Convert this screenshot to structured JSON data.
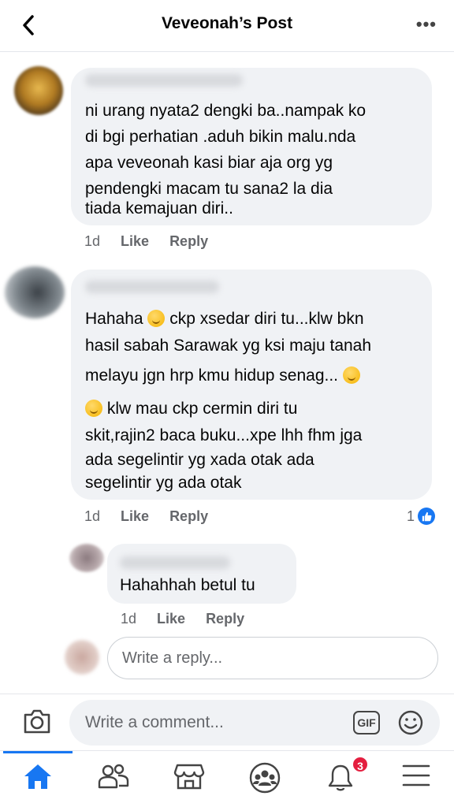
{
  "header": {
    "title": "Veveonah’s Post",
    "back_icon": "chevron-left-icon",
    "more_icon": "ellipsis-icon"
  },
  "comments": [
    {
      "lines": [
        "ni urang nyata2 dengki ba..nampak ko",
        "di bgi perhatian .aduh bikin malu.nda",
        "apa veveonah kasi biar aja org yg",
        "pendengki macam tu sana2 la dia",
        "tiada kemajuan diri.."
      ],
      "time": "1d",
      "like": "Like",
      "reply": "Reply"
    },
    {
      "lines": [
        "Hahaha",
        "ckp xsedar diri tu...klw bkn",
        "hasil sabah Sarawak yg ksi maju tanah",
        "melayu jgn hrp kmu hidup senag...",
        "klw mau ckp cermin diri tu",
        "skit,rajin2 baca buku...xpe lhh fhm jga",
        "ada segelintir yg xada otak ada",
        "segelintir yg ada otak"
      ],
      "time": "1d",
      "like": "Like",
      "reply": "Reply",
      "reactions": "1"
    },
    {
      "lines": [
        "Hahahhah betul tu"
      ],
      "time": "1d",
      "like": "Like",
      "reply": "Reply"
    }
  ],
  "reply_box": {
    "placeholder": "Write a reply..."
  },
  "comment_bar": {
    "placeholder": "Write a comment...",
    "gif_label": "GIF",
    "camera_icon": "camera-icon",
    "emoji_icon": "smiley-icon"
  },
  "nav": {
    "items": [
      "home-icon",
      "friends-icon",
      "marketplace-icon",
      "groups-icon",
      "notifications-icon",
      "menu-icon"
    ],
    "notification_badge": "3",
    "active_color": "#1877f2"
  }
}
